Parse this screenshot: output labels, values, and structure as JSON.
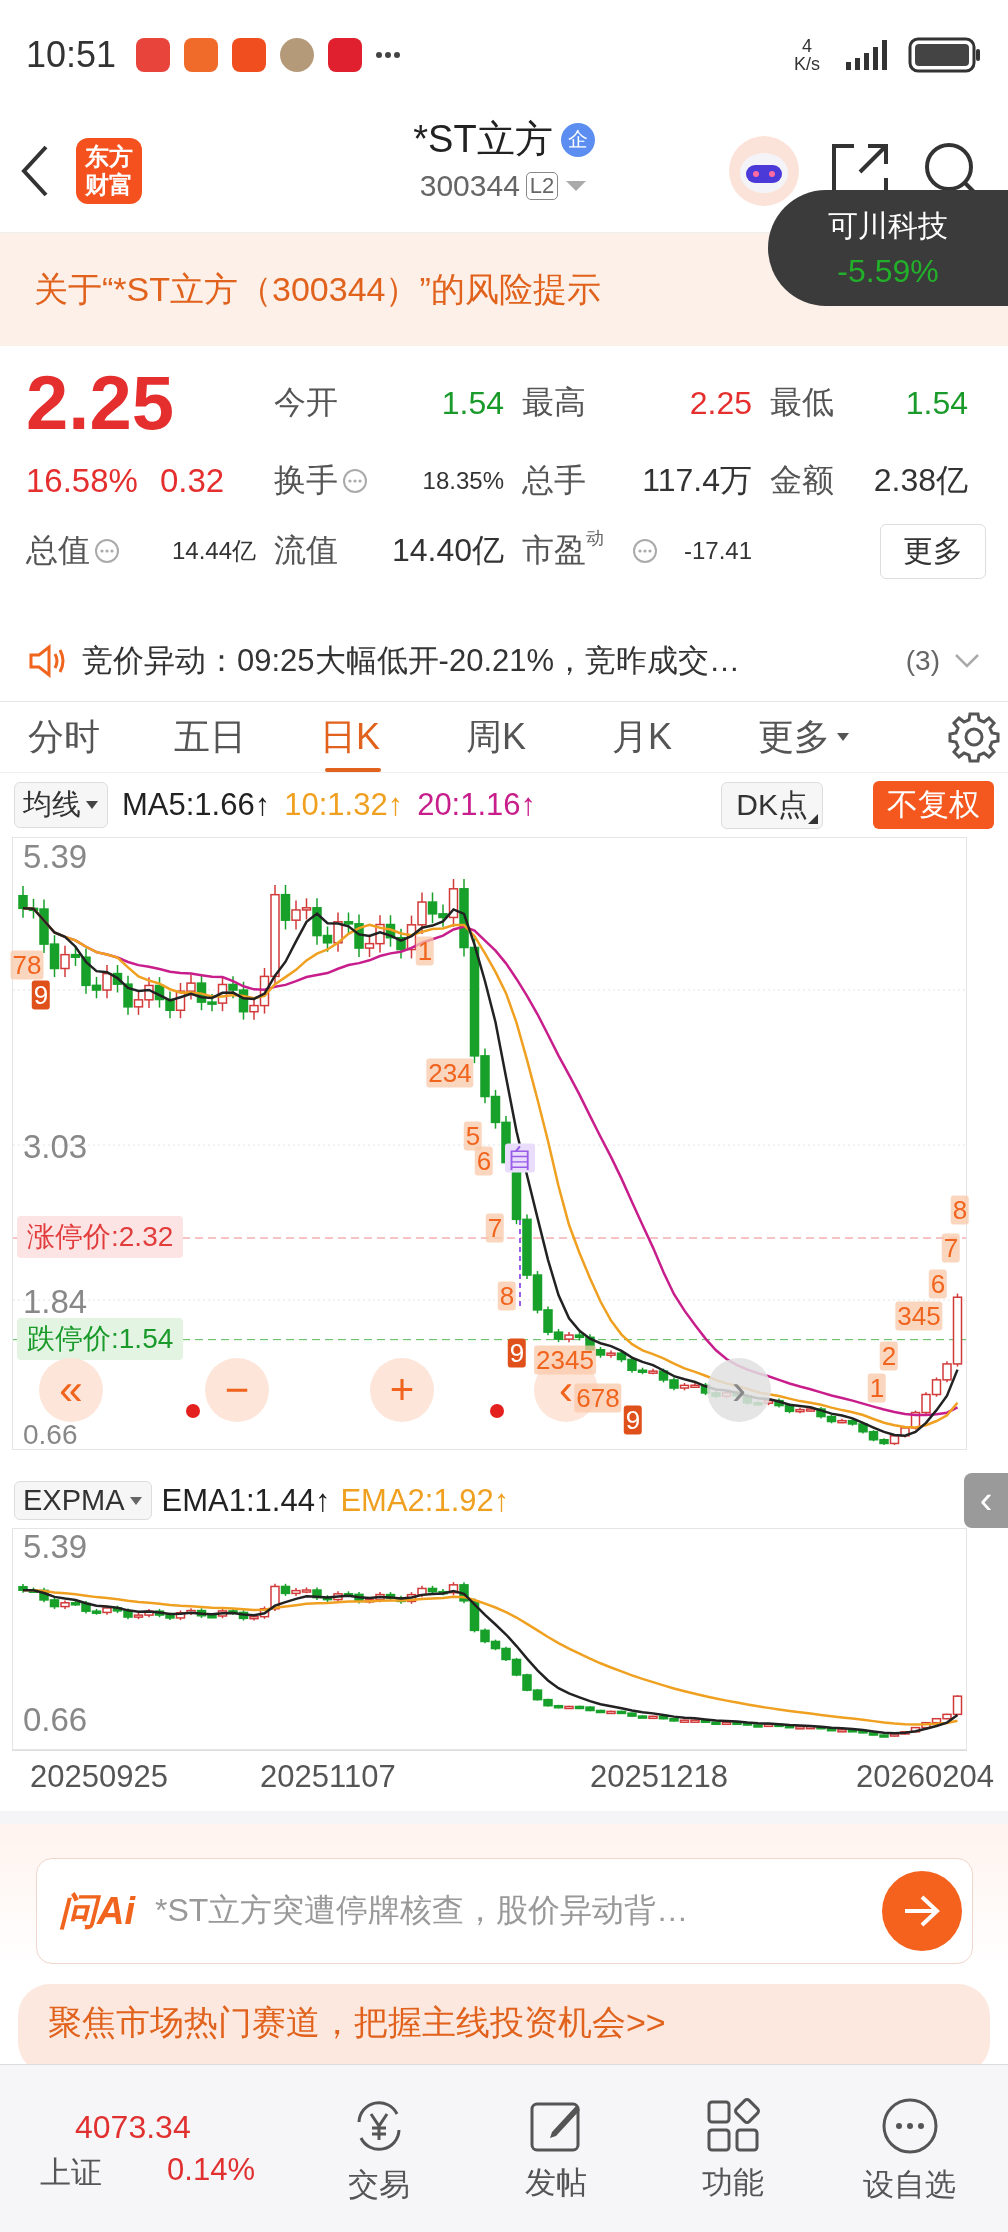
{
  "status_bar": {
    "time": "10:51",
    "net_speed_value": "4",
    "net_speed_unit": "K/s"
  },
  "header": {
    "logo_lines": [
      "东方",
      "财富"
    ],
    "title": "*ST立方",
    "badge": "企",
    "code": "300344",
    "level": "L2"
  },
  "toast": {
    "name": "可川科技",
    "change": "-5.59%"
  },
  "risk_banner": {
    "text": "关于“*ST立方（300344）”的风险提示"
  },
  "quote": {
    "price": "2.25",
    "change_pct": "16.58%",
    "change": "0.32",
    "more_button": "更多",
    "stats": [
      {
        "label": "今开",
        "value": "1.54",
        "color": "#1a9a2a",
        "info": false
      },
      {
        "label": "最高",
        "value": "2.25",
        "color": "#e52e2e",
        "info": false
      },
      {
        "label": "最低",
        "value": "1.54",
        "color": "#1a9a2a",
        "info": false
      },
      {
        "label": "换手",
        "value": "18.35%",
        "color": "#333333",
        "info": true
      },
      {
        "label": "总手",
        "value": "117.4万",
        "color": "#333333",
        "info": false
      },
      {
        "label": "金额",
        "value": "2.38亿",
        "color": "#333333",
        "info": false
      },
      {
        "label": "总值",
        "value": "14.44亿",
        "color": "#333333",
        "info": true
      },
      {
        "label": "流值",
        "value": "14.40亿",
        "color": "#333333",
        "info": false
      },
      {
        "label": "市盈",
        "sup": "动",
        "value": "-17.41",
        "color": "#333333",
        "info": true
      }
    ]
  },
  "notice": {
    "text": "竞价异动：09:25大幅低开-20.21%，竞昨成交…",
    "count": "(3)"
  },
  "tabs": [
    {
      "label": "分时",
      "selected": false,
      "dropdown": false
    },
    {
      "label": "五日",
      "selected": false,
      "dropdown": false
    },
    {
      "label": "日K",
      "selected": true,
      "dropdown": false
    },
    {
      "label": "周K",
      "selected": false,
      "dropdown": false
    },
    {
      "label": "月K",
      "selected": false,
      "dropdown": false
    },
    {
      "label": "更多",
      "selected": false,
      "dropdown": true
    }
  ],
  "ma_bar": {
    "indicator": "均线",
    "items": [
      {
        "text": "MA5:1.66↑",
        "color": "#222222"
      },
      {
        "text": "10:1.32↑",
        "color": "#f0a020"
      },
      {
        "text": "20:1.16↑",
        "color": "#c81e8c"
      }
    ],
    "dk_button": "DK点",
    "fq_button": "不复权"
  },
  "main_chart": {
    "y_labels": [
      "5.39",
      "3.03",
      "1.84",
      "0.66"
    ],
    "limit_up": "涨停价:2.32",
    "limit_down": "跌停价:1.54",
    "marks": [
      {
        "text": "78",
        "kind": "outline"
      },
      {
        "text": "9",
        "kind": "filled"
      },
      {
        "text": "1",
        "kind": "outline"
      },
      {
        "text": "234",
        "kind": "outline"
      },
      {
        "text": "5",
        "kind": "outline"
      },
      {
        "text": "6",
        "kind": "outline"
      },
      {
        "text": "自",
        "kind": "self"
      },
      {
        "text": "7",
        "kind": "outline"
      },
      {
        "text": "8",
        "kind": "outline"
      },
      {
        "text": "9",
        "kind": "filled"
      },
      {
        "text": "2345",
        "kind": "outline"
      },
      {
        "text": "678",
        "kind": "outline"
      },
      {
        "text": "9",
        "kind": "filled"
      },
      {
        "text": "1",
        "kind": "outline"
      },
      {
        "text": "2",
        "kind": "outline"
      },
      {
        "text": "345",
        "kind": "outline"
      },
      {
        "text": "6",
        "kind": "outline"
      },
      {
        "text": "7",
        "kind": "outline"
      },
      {
        "text": "8",
        "kind": "outline"
      }
    ],
    "controls": [
      "«",
      "−",
      "+",
      "‹",
      "›"
    ]
  },
  "sub_bar": {
    "indicator": "EXPMA",
    "items": [
      {
        "text": "EMA1:1.44↑",
        "color": "#222222"
      },
      {
        "text": "EMA2:1.92↑",
        "color": "#f0a020"
      }
    ],
    "collapse": "‹"
  },
  "sub_chart": {
    "y_labels": [
      "5.39",
      "0.66"
    ]
  },
  "dates": [
    "20250925",
    "20251107",
    "20251218",
    "20260204"
  ],
  "ai_bar": {
    "logo": "问Ai",
    "text": "*ST立方突遭停牌核查，股价异动背…"
  },
  "promo": {
    "text": "聚焦市场热门赛道，把握主线投资机会>>"
  },
  "bottom_nav": {
    "index_value": "4073.34",
    "index_name": "上证",
    "index_change": "0.14%",
    "items": [
      {
        "label": "交易",
        "kind": "trade"
      },
      {
        "label": "发帖",
        "kind": "post"
      },
      {
        "label": "功能",
        "kind": "apps"
      },
      {
        "label": "设自选",
        "kind": "more"
      }
    ]
  }
}
